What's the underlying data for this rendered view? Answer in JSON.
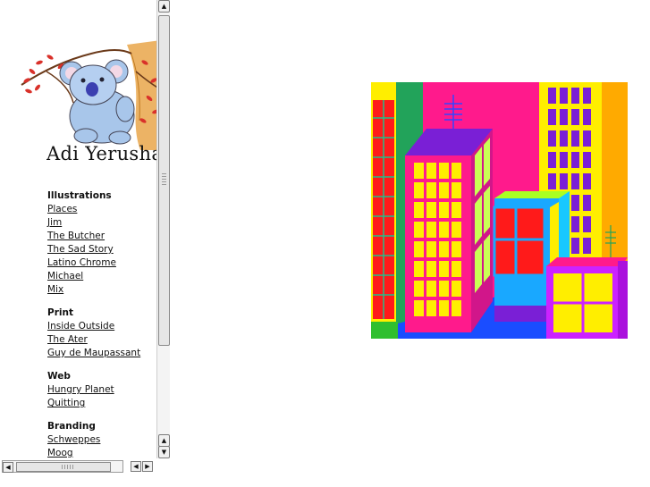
{
  "brand": {
    "name": "Adi Yerushalmi"
  },
  "nav": {
    "sections": [
      {
        "title": "Illustrations",
        "items": [
          "Places",
          "Jim",
          "The Butcher",
          "The Sad Story",
          "Latino Chrome",
          "Michael",
          "Mix"
        ]
      },
      {
        "title": "Print",
        "items": [
          "Inside Outside",
          "The Ater",
          "Guy de Maupassant"
        ]
      },
      {
        "title": "Web",
        "items": [
          "Hungry Planet",
          "Quitting"
        ]
      },
      {
        "title": "Branding",
        "items": [
          "Schweppes",
          "Moog"
        ]
      }
    ]
  },
  "icons": {
    "logo": "koala-illustration",
    "scroll_up": "arrow-up-icon",
    "scroll_down": "arrow-down-icon",
    "scroll_left": "arrow-left-icon",
    "scroll_right": "arrow-right-icon"
  },
  "colors": {
    "artwork_magenta": "#ff1a8c",
    "artwork_yellow": "#ffee00",
    "artwork_purple": "#7a1fd6",
    "artwork_red": "#ff1a1a",
    "artwork_blue": "#1a4dff",
    "artwork_cyan": "#19a8ff",
    "artwork_orange": "#ffaa00",
    "artwork_green": "#22a35a",
    "artwork_lime": "#aaff22"
  }
}
